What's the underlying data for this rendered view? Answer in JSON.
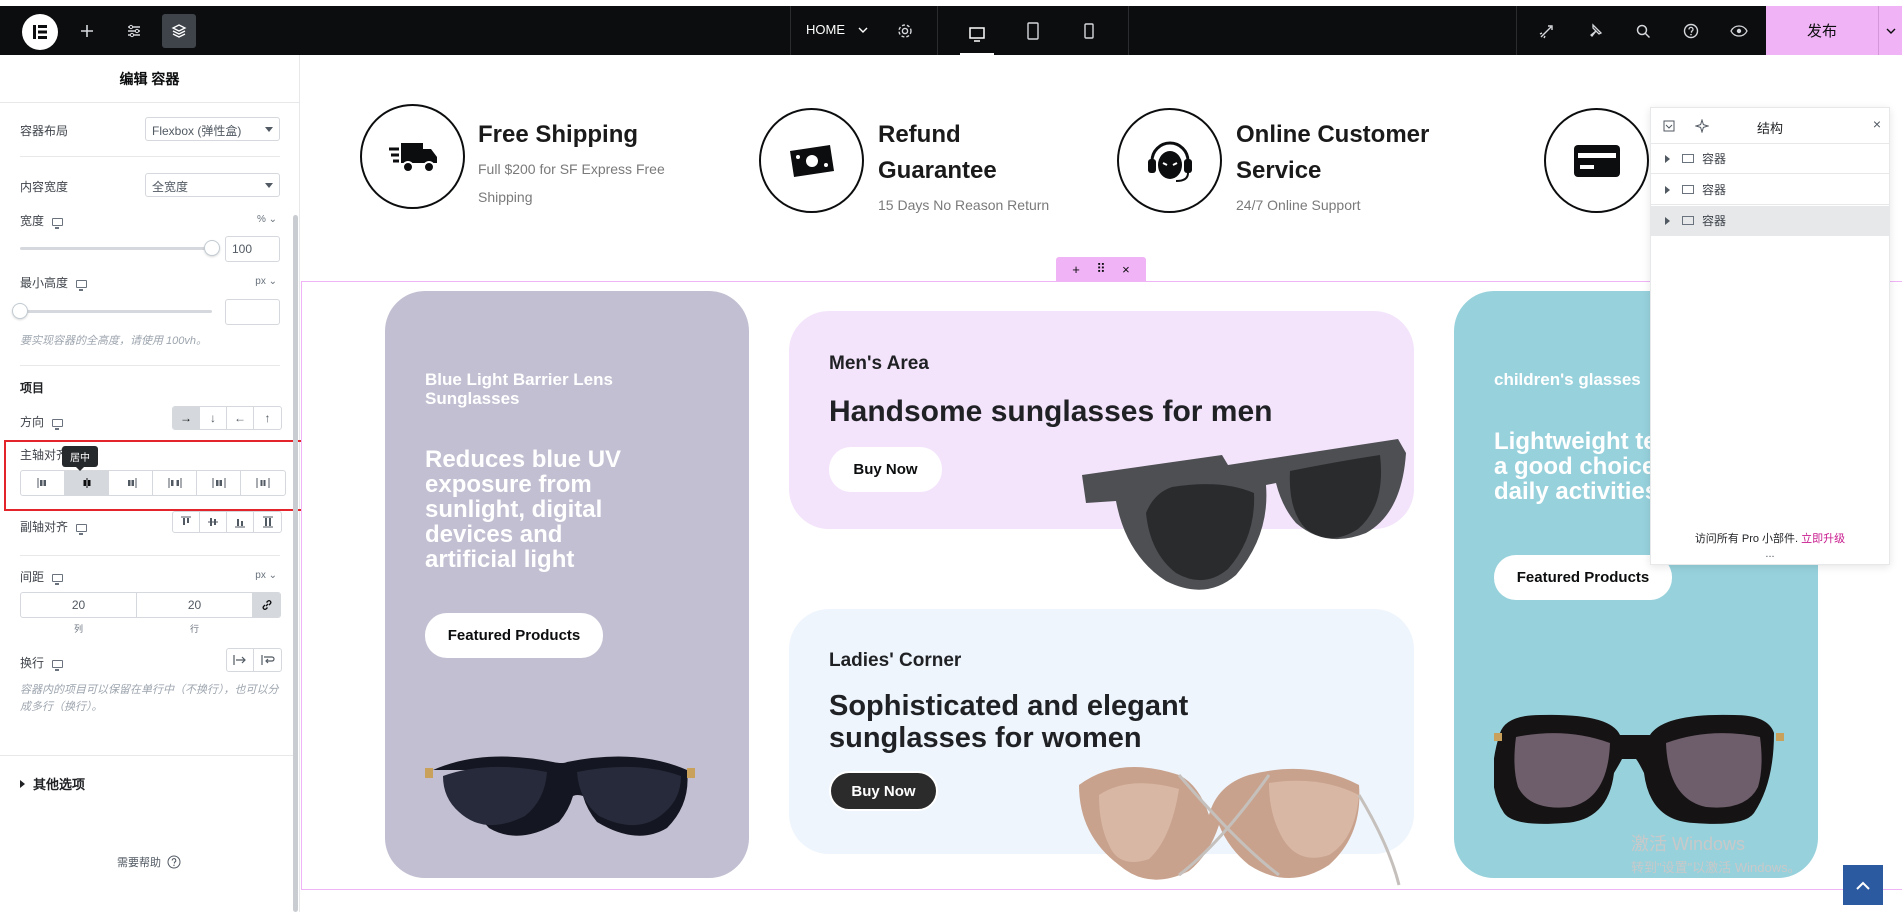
{
  "topbar": {
    "page_selector": "HOME",
    "publish_label": "发布"
  },
  "panel": {
    "title": "编辑 容器",
    "container_layout": {
      "label": "容器布局",
      "value": "Flexbox (弹性盒)"
    },
    "content_width": {
      "label": "内容宽度",
      "value": "全宽度"
    },
    "width": {
      "label": "宽度",
      "unit": "% ⌄",
      "value": "100",
      "slider_fraction": 0.96
    },
    "min_height": {
      "label": "最小高度",
      "unit": "px ⌄",
      "value": ""
    },
    "min_height_hint": "要实现容器的全高度，请使用 100vh。",
    "items_heading": "项目",
    "direction": {
      "label": "方向",
      "icons": [
        "→",
        "↓",
        "←",
        "↑"
      ],
      "active": 0
    },
    "justify": {
      "label": "主轴对齐",
      "tooltip": "居中",
      "active": 1
    },
    "align": {
      "label": "副轴对齐"
    },
    "gap": {
      "label": "间距",
      "unit": "px ⌄",
      "column": "20",
      "row": "20",
      "column_label": "列",
      "row_label": "行"
    },
    "wrap": {
      "label": "换行"
    },
    "wrap_hint": "容器内的项目可以保留在单行中（不换行），也可以分成多行（换行）。",
    "more_options": "其他选项",
    "help": "需要帮助"
  },
  "features": [
    {
      "title": "Free Shipping",
      "sub": "Full $200 for SF Express Free Shipping",
      "icon": "truck-icon"
    },
    {
      "title": "Refund Guarantee",
      "sub": "15 Days No Reason Return",
      "icon": "money-icon"
    },
    {
      "title": "Online Customer Service",
      "sub": "24/7 Online Support",
      "icon": "headset-icon"
    },
    {
      "title": "",
      "sub": "",
      "icon": "credit-card-icon"
    }
  ],
  "cards": {
    "blue_light": {
      "eyebrow": "Blue Light Barrier Lens Sunglasses",
      "headline": "Reduces blue UV exposure from sunlight, digital devices and artificial light",
      "button": "Featured Products",
      "bg": "#c1bfd1"
    },
    "mens": {
      "eyebrow": "Men's Area",
      "headline": "Handsome sunglasses for men",
      "button": "Buy Now",
      "bg": "#f3e3fb"
    },
    "ladies": {
      "eyebrow": "Ladies' Corner",
      "headline": "Sophisticated and elegant sunglasses for women",
      "button": "Buy Now",
      "bg": "#eef5fd"
    },
    "children": {
      "eyebrow": "children's glasses",
      "headline": "Lightweight te a good choice daily activities",
      "button": "Featured Products",
      "bg": "#97d1dc"
    }
  },
  "structure": {
    "title": "结构",
    "items": [
      "容器",
      "容器",
      "容器"
    ],
    "selected_index": 2,
    "pro_text": "访问所有 Pro 小部件.",
    "upgrade_link": "立即升级",
    "more": "..."
  },
  "watermark": {
    "line1": "激活 Windows",
    "line2": "转到\"设置\"以激活 Windows。"
  },
  "colors": {
    "accent": "#f0b3f5",
    "topbar": "#0c0d0e",
    "highlight_box": "#e3242b"
  }
}
